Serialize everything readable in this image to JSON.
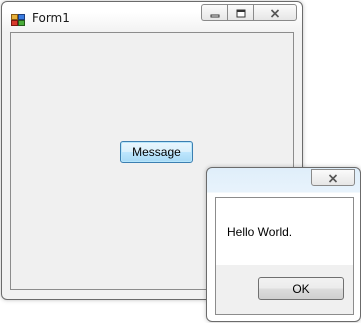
{
  "form1": {
    "title": "Form1",
    "app_icon": "windows-form-icon",
    "caption_icons": [
      "minimize-icon",
      "maximize-icon",
      "close-icon"
    ],
    "message_button_label": "Message"
  },
  "message_box": {
    "text": "Hello World.",
    "ok_label": "OK",
    "caption_icons": [
      "close-icon"
    ]
  }
}
